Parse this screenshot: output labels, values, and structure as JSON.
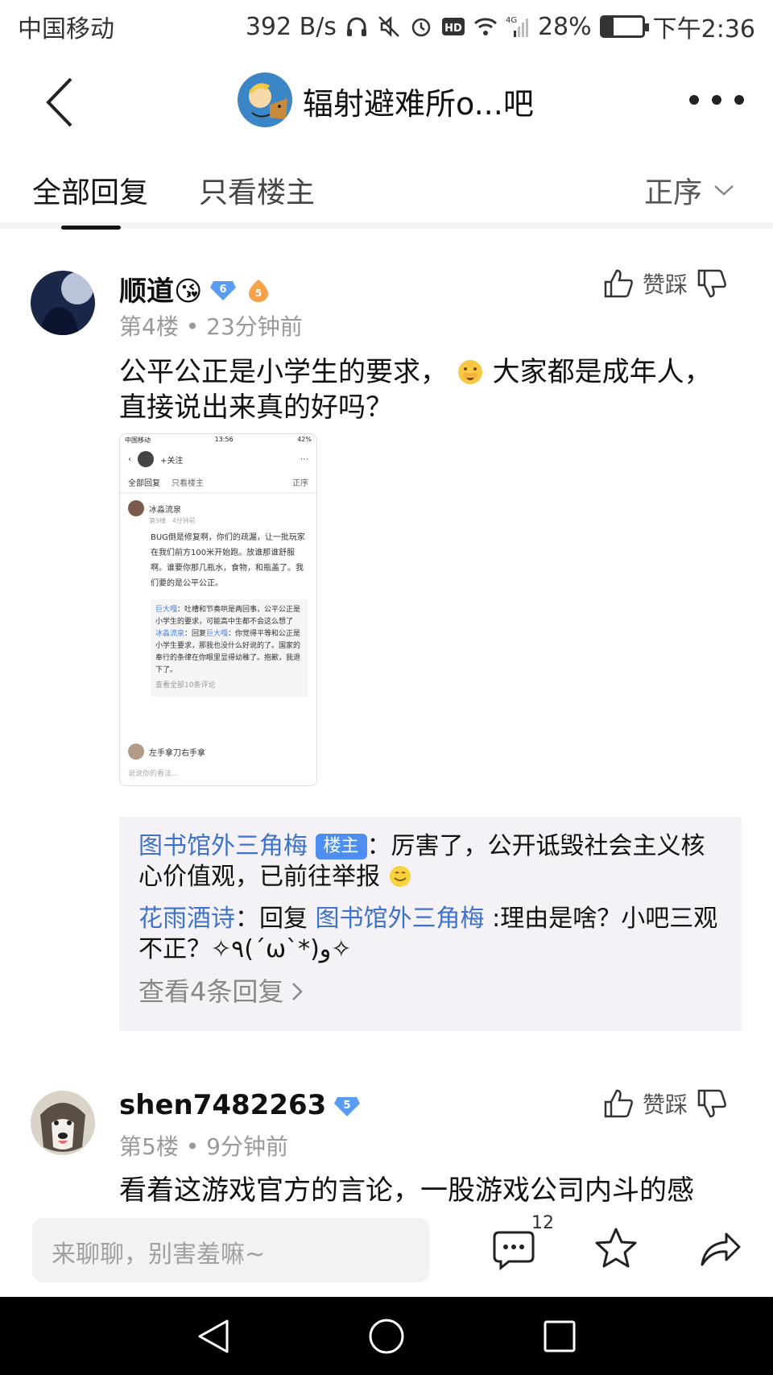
{
  "status_bar": {
    "carrier": "中国移动",
    "speed": "392 B/s",
    "network": "4G",
    "battery": "28%",
    "battery_level": 0.28,
    "time": "下午2:36"
  },
  "nav": {
    "title": "辐射避难所o...吧"
  },
  "tabs": {
    "all": "全部回复",
    "op_only": "只看楼主",
    "sort": "正序"
  },
  "posts": [
    {
      "username": "顺道😘",
      "level": "6",
      "badge": "5",
      "floor": "第4楼",
      "time": "23分钟前",
      "vote_label": "赞踩",
      "text_line1": "公平公正是小学生的要求，",
      "text_line1b": "大家都是成年人，",
      "text_line2": "直接说出来真的好吗？",
      "shot": {
        "status_left": "中国移动",
        "status_time": "13:56",
        "status_batt": "42%",
        "follow": "+关注",
        "tab_all": "全部回复",
        "tab_op": "只看楼主",
        "sort": "正序",
        "user": "冰淼流泉",
        "user_meta": "第9楼 · 4分钟前",
        "body": "BUG倒是修复啊，你们的疏漏，让一批玩家在我们前方100米开始跑。放谁那谁舒服啊。谁要你那几瓶水，食物，和瓶盖了。我们要的是公平公正。",
        "reply1_user": "巨大嘎",
        "reply1_text": "：吐槽和节奏哄是两回事，公平公正是小学生的要求，可能高中生都不会这么想了",
        "reply2_user": "冰淼流泉",
        "reply2_mid": "：回复",
        "reply2_target": "巨大嘎",
        "reply2_text": "：你觉得平等和公正是小学生要求，那我也没什么好说的了。国家的奉行的条律在你眼里显得幼稚了。抱歉，我退下了。",
        "more": "查看全部10条评论",
        "user2": "左手拿刀右手拿",
        "input": "说说你的看法..."
      },
      "replies": {
        "r1_user": "图书馆外三角梅",
        "r1_badge": "楼主",
        "r1_text": "：厉害了，公开诋毁社会主义核心价值观，已前往举报",
        "r2_user": "花雨酒诗",
        "r2_mid": "：回复 ",
        "r2_target": "图书馆外三角梅",
        "r2_text": " :理由是啥？小吧三观不正？✧٩(ˊωˋ*)و✧",
        "more": "查看4条回复"
      }
    },
    {
      "username": "shen7482263",
      "level": "5",
      "floor": "第5楼",
      "time": "9分钟前",
      "vote_label": "赞踩",
      "text_line1": "看着这游戏官方的言论，一股游戏公司内斗的感"
    }
  ],
  "bottom": {
    "placeholder": "来聊聊，别害羞嘛~",
    "comment_count": "12"
  },
  "icons": [
    "back-icon",
    "more-icon",
    "chevron-down-icon",
    "thumbs-up-icon",
    "thumbs-down-icon",
    "comment-icon",
    "star-icon",
    "share-icon"
  ]
}
